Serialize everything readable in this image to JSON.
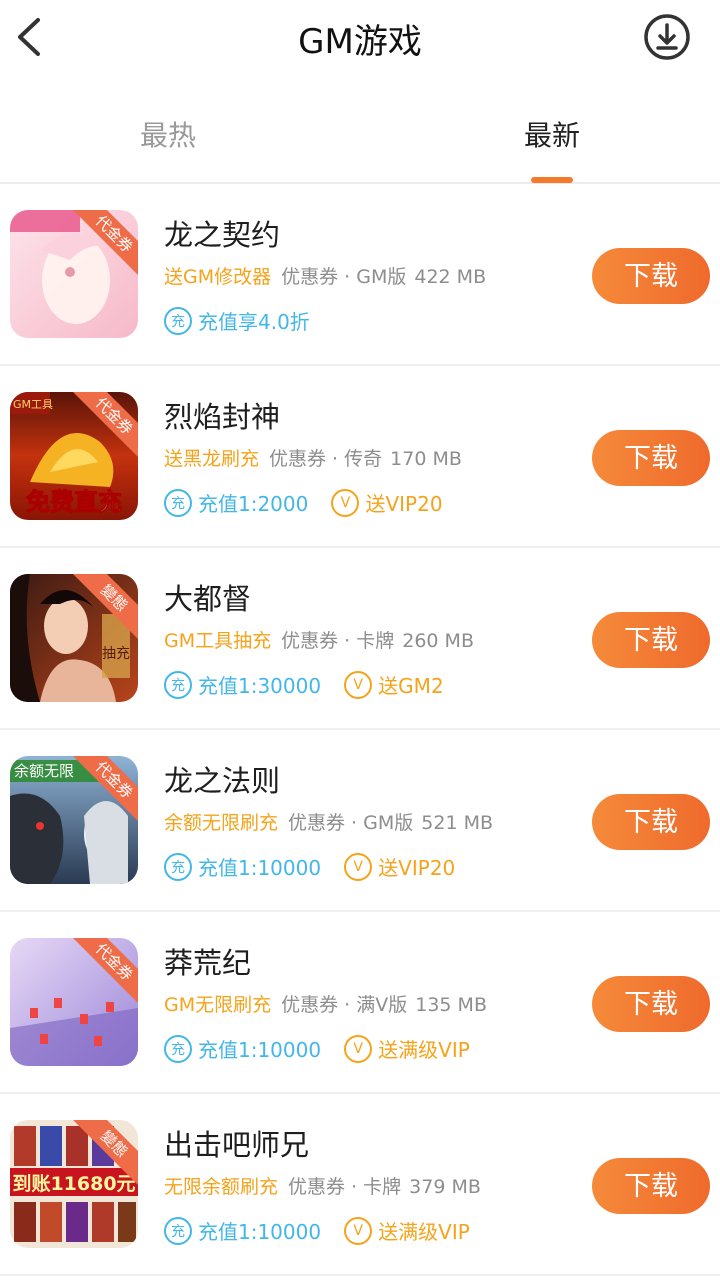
{
  "header": {
    "title": "GM游戏",
    "back_icon": "back-arrow-icon",
    "download_icon": "download-icon"
  },
  "tabs": [
    {
      "label": "最热",
      "active": false
    },
    {
      "label": "最新",
      "active": true
    }
  ],
  "accent_color": "#f47a2c",
  "games": [
    {
      "name": "龙之契约",
      "promo": "送GM修改器",
      "meta": "优惠券 · GM版",
      "size": "422 MB",
      "charge_icon": "充",
      "charge": "充值享4.0折",
      "vip_icon": "",
      "vip": "",
      "ribbon": "代金券",
      "download_label": "下载"
    },
    {
      "name": "烈焰封神",
      "promo": "送黑龙刷充",
      "meta": "优惠券 · 传奇",
      "size": "170 MB",
      "charge_icon": "充",
      "charge": "充值1:2000",
      "vip_icon": "V",
      "vip": "送VIP20",
      "ribbon": "代金券",
      "icon_text": "免费直充",
      "icon_badge": "GM工具",
      "download_label": "下载"
    },
    {
      "name": "大都督",
      "promo": "GM工具抽充",
      "meta": "优惠券 · 卡牌",
      "size": "260 MB",
      "charge_icon": "充",
      "charge": "充值1:30000",
      "vip_icon": "V",
      "vip": "送GM2",
      "ribbon": "變態",
      "icon_text": "抽充",
      "download_label": "下载"
    },
    {
      "name": "龙之法则",
      "promo": "余额无限刷充",
      "meta": "优惠券 · GM版",
      "size": "521 MB",
      "charge_icon": "充",
      "charge": "充值1:10000",
      "vip_icon": "V",
      "vip": "送VIP20",
      "ribbon": "代金券",
      "icon_text": "余额无限",
      "download_label": "下载"
    },
    {
      "name": "莽荒纪",
      "promo": "GM无限刷充",
      "meta": "优惠券 · 满V版",
      "size": "135 MB",
      "charge_icon": "充",
      "charge": "充值1:10000",
      "vip_icon": "V",
      "vip": "送满级VIP",
      "ribbon": "代金券",
      "download_label": "下载"
    },
    {
      "name": "出击吧师兄",
      "promo": "无限余额刷充",
      "meta": "优惠券 · 卡牌",
      "size": "379 MB",
      "charge_icon": "充",
      "charge": "充值1:10000",
      "vip_icon": "V",
      "vip": "送满级VIP",
      "ribbon": "變態",
      "icon_text": "到账11680元",
      "download_label": "下载"
    }
  ]
}
